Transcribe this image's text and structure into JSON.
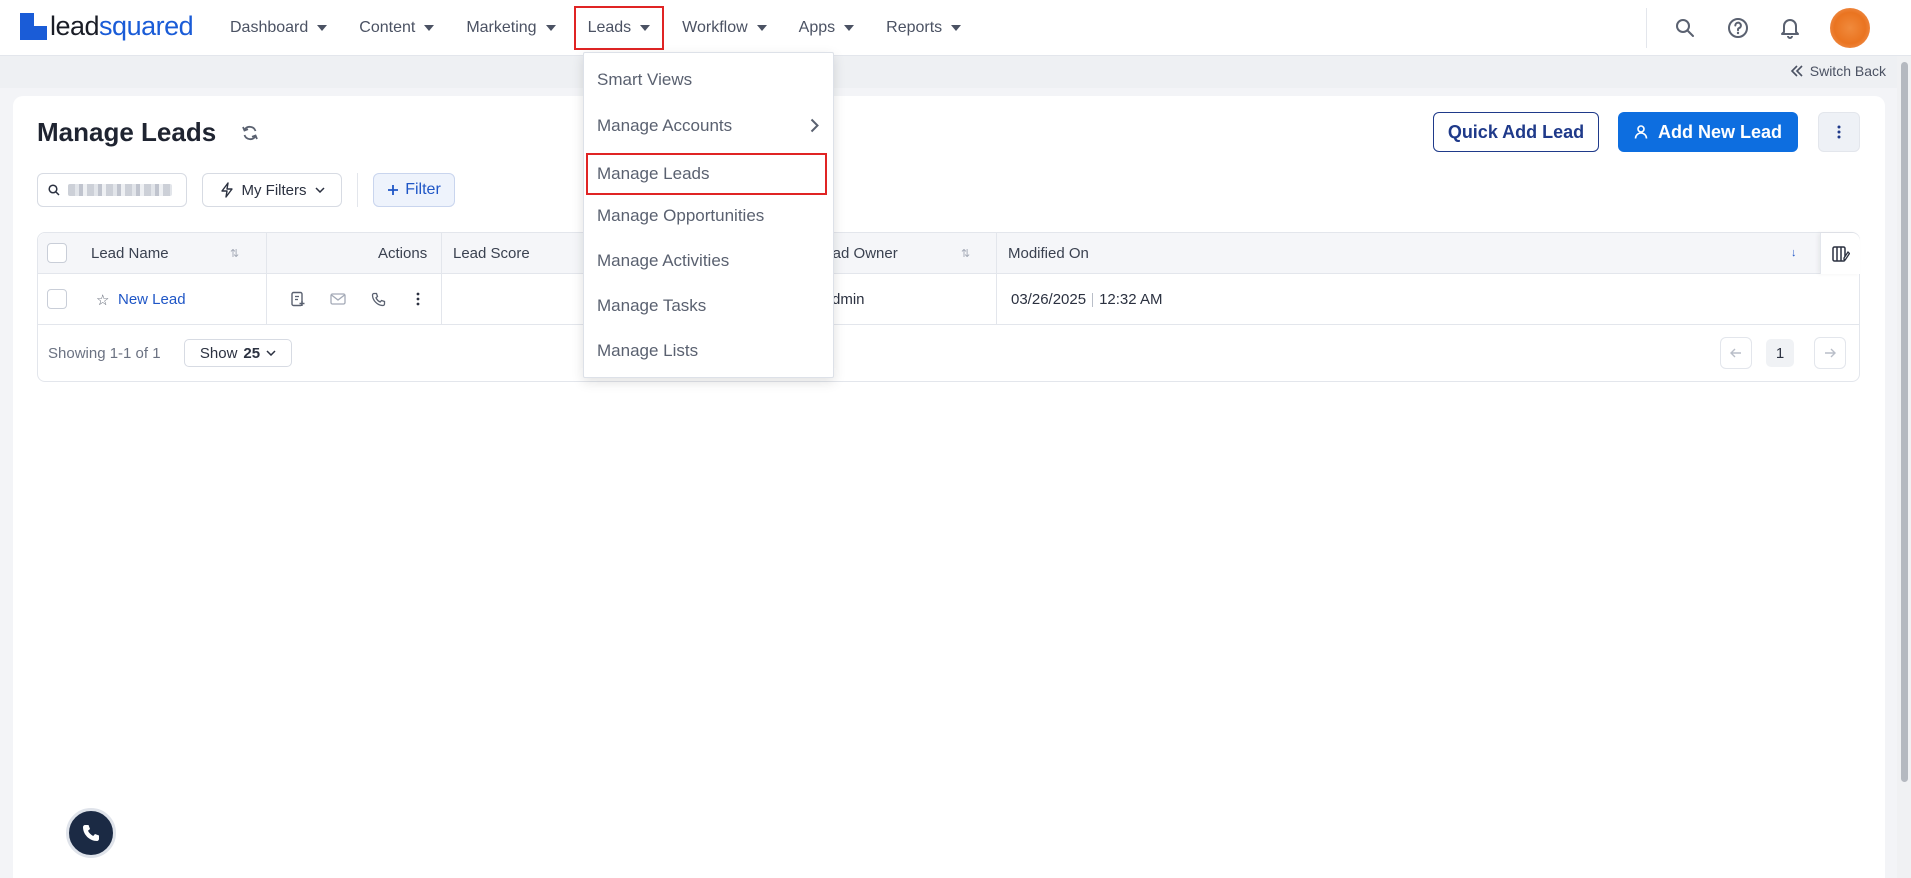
{
  "brand": {
    "logo_part1": "lead",
    "logo_part2": "squared"
  },
  "nav": {
    "items": [
      {
        "label": "Dashboard"
      },
      {
        "label": "Content"
      },
      {
        "label": "Marketing"
      },
      {
        "label": "Leads"
      },
      {
        "label": "Workflow"
      },
      {
        "label": "Apps"
      },
      {
        "label": "Reports"
      }
    ],
    "active": "Leads"
  },
  "topbar_icons": [
    "search-icon",
    "help-icon",
    "bell-icon",
    "avatar"
  ],
  "subbar": {
    "switch_back": "Switch Back"
  },
  "page": {
    "title": "Manage Leads",
    "quick_add": "Quick Add Lead",
    "add_new": "Add New Lead"
  },
  "filters": {
    "my_filters": "My Filters",
    "filter": "Filter"
  },
  "table": {
    "headers": {
      "lead_name": "Lead Name",
      "actions": "Actions",
      "lead_score": "Lead Score",
      "lead_owner": "Lead Owner",
      "modified_on": "Modified On"
    },
    "rows": [
      {
        "lead_name": "New Lead",
        "lead_owner": "Admin",
        "modified_date": "03/26/2025",
        "modified_time": "12:32 AM"
      }
    ]
  },
  "pagination": {
    "showing": "Showing 1-1 of 1",
    "show_label": "Show",
    "show_value": "25",
    "current_page": "1"
  },
  "dropdown": {
    "items": [
      {
        "label": "Smart Views"
      },
      {
        "label": "Manage Accounts"
      },
      {
        "label": "Manage Leads"
      },
      {
        "label": "Manage Opportunities"
      },
      {
        "label": "Manage Activities"
      },
      {
        "label": "Manage Tasks"
      },
      {
        "label": "Manage Lists"
      }
    ],
    "highlighted": "Manage Leads"
  },
  "colors": {
    "brand_blue": "#1a5cd7",
    "primary_button": "#0d6ee0",
    "highlight_red": "#e02424",
    "link_blue": "#1f56c6"
  }
}
